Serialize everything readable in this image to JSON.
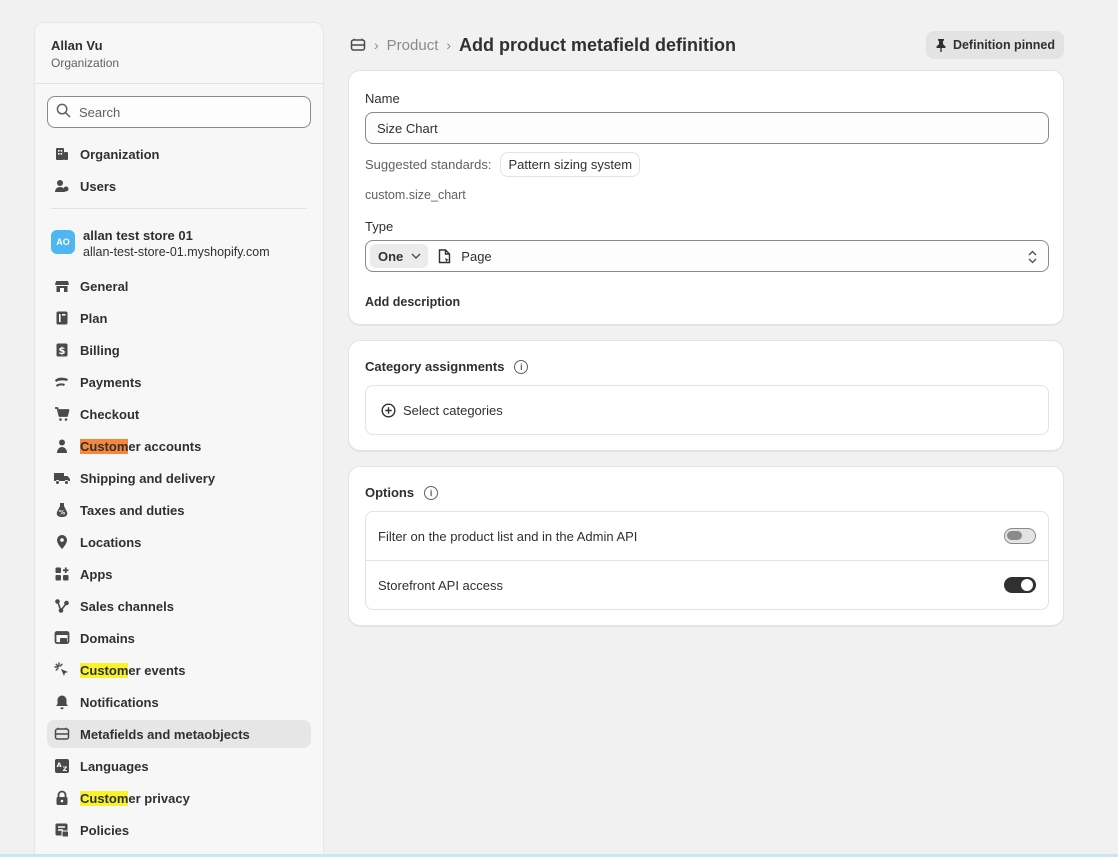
{
  "sidebar": {
    "org_name": "Allan Vu",
    "org_type": "Organization",
    "search_placeholder": "Search",
    "top_items": [
      {
        "label": "Organization",
        "icon": "building-icon"
      },
      {
        "label": "Users",
        "icon": "users-icon"
      }
    ],
    "store": {
      "avatar": "AO",
      "name": "allan test store 01",
      "url": "allan-test-store-01.myshopify.com"
    },
    "items": [
      {
        "label": "General",
        "icon": "store-icon"
      },
      {
        "label": "Plan",
        "icon": "plan-icon"
      },
      {
        "label": "Billing",
        "icon": "billing-icon"
      },
      {
        "label": "Payments",
        "icon": "payments-icon"
      },
      {
        "label": "Checkout",
        "icon": "cart-icon"
      },
      {
        "label_hl": "Custom",
        "label_rest": "er accounts",
        "hl_color": "#f5873a",
        "icon": "person-icon"
      },
      {
        "label": "Shipping and delivery",
        "icon": "truck-icon"
      },
      {
        "label": "Taxes and duties",
        "icon": "tax-icon"
      },
      {
        "label": "Locations",
        "icon": "location-icon"
      },
      {
        "label": "Apps",
        "icon": "apps-icon"
      },
      {
        "label": "Sales channels",
        "icon": "channels-icon"
      },
      {
        "label": "Domains",
        "icon": "domains-icon"
      },
      {
        "label_hl": "Custom",
        "label_rest": "er events",
        "hl_color": "#f8f22c",
        "icon": "cursor-click-icon"
      },
      {
        "label": "Notifications",
        "icon": "bell-icon"
      },
      {
        "label": "Metafields and metaobjects",
        "icon": "metafields-icon",
        "active": true
      },
      {
        "label": "Languages",
        "icon": "language-icon"
      },
      {
        "label_hl": "Custom",
        "label_rest": "er privacy",
        "hl_color": "#f8f22c",
        "icon": "lock-icon"
      },
      {
        "label": "Policies",
        "icon": "policies-icon"
      }
    ]
  },
  "header": {
    "breadcrumb": "Product",
    "title": "Add product metafield definition",
    "pin_label": "Definition pinned"
  },
  "definition": {
    "name_label": "Name",
    "name_value": "Size Chart",
    "suggested_label": "Suggested standards:",
    "suggested_pill": "Pattern sizing system",
    "namespace_key": "custom.size_chart",
    "type_label": "Type",
    "type_count": "One",
    "type_value": "Page",
    "add_description": "Add description"
  },
  "categories": {
    "title": "Category assignments",
    "select_label": "Select categories"
  },
  "options": {
    "title": "Options",
    "rows": [
      {
        "label": "Filter on the product list and in the Admin API",
        "enabled": false
      },
      {
        "label": "Storefront API access",
        "enabled": true
      }
    ]
  }
}
